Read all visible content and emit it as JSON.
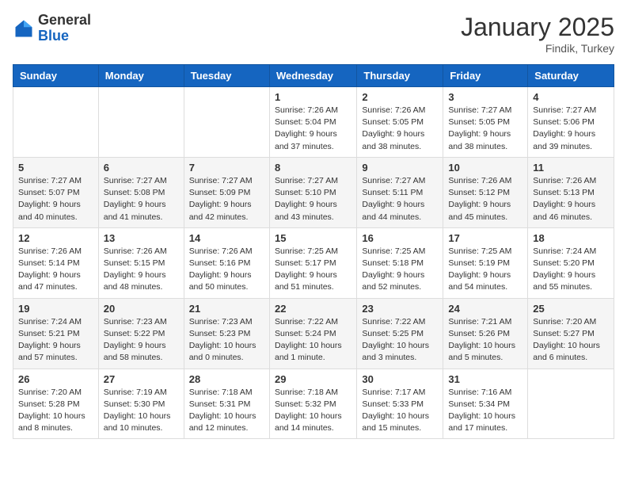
{
  "logo": {
    "general": "General",
    "blue": "Blue"
  },
  "header": {
    "month_year": "January 2025",
    "location": "Findik, Turkey"
  },
  "weekdays": [
    "Sunday",
    "Monday",
    "Tuesday",
    "Wednesday",
    "Thursday",
    "Friday",
    "Saturday"
  ],
  "weeks": [
    [
      {
        "day": "",
        "info": ""
      },
      {
        "day": "",
        "info": ""
      },
      {
        "day": "",
        "info": ""
      },
      {
        "day": "1",
        "info": "Sunrise: 7:26 AM\nSunset: 5:04 PM\nDaylight: 9 hours and 37 minutes."
      },
      {
        "day": "2",
        "info": "Sunrise: 7:26 AM\nSunset: 5:05 PM\nDaylight: 9 hours and 38 minutes."
      },
      {
        "day": "3",
        "info": "Sunrise: 7:27 AM\nSunset: 5:05 PM\nDaylight: 9 hours and 38 minutes."
      },
      {
        "day": "4",
        "info": "Sunrise: 7:27 AM\nSunset: 5:06 PM\nDaylight: 9 hours and 39 minutes."
      }
    ],
    [
      {
        "day": "5",
        "info": "Sunrise: 7:27 AM\nSunset: 5:07 PM\nDaylight: 9 hours and 40 minutes."
      },
      {
        "day": "6",
        "info": "Sunrise: 7:27 AM\nSunset: 5:08 PM\nDaylight: 9 hours and 41 minutes."
      },
      {
        "day": "7",
        "info": "Sunrise: 7:27 AM\nSunset: 5:09 PM\nDaylight: 9 hours and 42 minutes."
      },
      {
        "day": "8",
        "info": "Sunrise: 7:27 AM\nSunset: 5:10 PM\nDaylight: 9 hours and 43 minutes."
      },
      {
        "day": "9",
        "info": "Sunrise: 7:27 AM\nSunset: 5:11 PM\nDaylight: 9 hours and 44 minutes."
      },
      {
        "day": "10",
        "info": "Sunrise: 7:26 AM\nSunset: 5:12 PM\nDaylight: 9 hours and 45 minutes."
      },
      {
        "day": "11",
        "info": "Sunrise: 7:26 AM\nSunset: 5:13 PM\nDaylight: 9 hours and 46 minutes."
      }
    ],
    [
      {
        "day": "12",
        "info": "Sunrise: 7:26 AM\nSunset: 5:14 PM\nDaylight: 9 hours and 47 minutes."
      },
      {
        "day": "13",
        "info": "Sunrise: 7:26 AM\nSunset: 5:15 PM\nDaylight: 9 hours and 48 minutes."
      },
      {
        "day": "14",
        "info": "Sunrise: 7:26 AM\nSunset: 5:16 PM\nDaylight: 9 hours and 50 minutes."
      },
      {
        "day": "15",
        "info": "Sunrise: 7:25 AM\nSunset: 5:17 PM\nDaylight: 9 hours and 51 minutes."
      },
      {
        "day": "16",
        "info": "Sunrise: 7:25 AM\nSunset: 5:18 PM\nDaylight: 9 hours and 52 minutes."
      },
      {
        "day": "17",
        "info": "Sunrise: 7:25 AM\nSunset: 5:19 PM\nDaylight: 9 hours and 54 minutes."
      },
      {
        "day": "18",
        "info": "Sunrise: 7:24 AM\nSunset: 5:20 PM\nDaylight: 9 hours and 55 minutes."
      }
    ],
    [
      {
        "day": "19",
        "info": "Sunrise: 7:24 AM\nSunset: 5:21 PM\nDaylight: 9 hours and 57 minutes."
      },
      {
        "day": "20",
        "info": "Sunrise: 7:23 AM\nSunset: 5:22 PM\nDaylight: 9 hours and 58 minutes."
      },
      {
        "day": "21",
        "info": "Sunrise: 7:23 AM\nSunset: 5:23 PM\nDaylight: 10 hours and 0 minutes."
      },
      {
        "day": "22",
        "info": "Sunrise: 7:22 AM\nSunset: 5:24 PM\nDaylight: 10 hours and 1 minute."
      },
      {
        "day": "23",
        "info": "Sunrise: 7:22 AM\nSunset: 5:25 PM\nDaylight: 10 hours and 3 minutes."
      },
      {
        "day": "24",
        "info": "Sunrise: 7:21 AM\nSunset: 5:26 PM\nDaylight: 10 hours and 5 minutes."
      },
      {
        "day": "25",
        "info": "Sunrise: 7:20 AM\nSunset: 5:27 PM\nDaylight: 10 hours and 6 minutes."
      }
    ],
    [
      {
        "day": "26",
        "info": "Sunrise: 7:20 AM\nSunset: 5:28 PM\nDaylight: 10 hours and 8 minutes."
      },
      {
        "day": "27",
        "info": "Sunrise: 7:19 AM\nSunset: 5:30 PM\nDaylight: 10 hours and 10 minutes."
      },
      {
        "day": "28",
        "info": "Sunrise: 7:18 AM\nSunset: 5:31 PM\nDaylight: 10 hours and 12 minutes."
      },
      {
        "day": "29",
        "info": "Sunrise: 7:18 AM\nSunset: 5:32 PM\nDaylight: 10 hours and 14 minutes."
      },
      {
        "day": "30",
        "info": "Sunrise: 7:17 AM\nSunset: 5:33 PM\nDaylight: 10 hours and 15 minutes."
      },
      {
        "day": "31",
        "info": "Sunrise: 7:16 AM\nSunset: 5:34 PM\nDaylight: 10 hours and 17 minutes."
      },
      {
        "day": "",
        "info": ""
      }
    ]
  ]
}
